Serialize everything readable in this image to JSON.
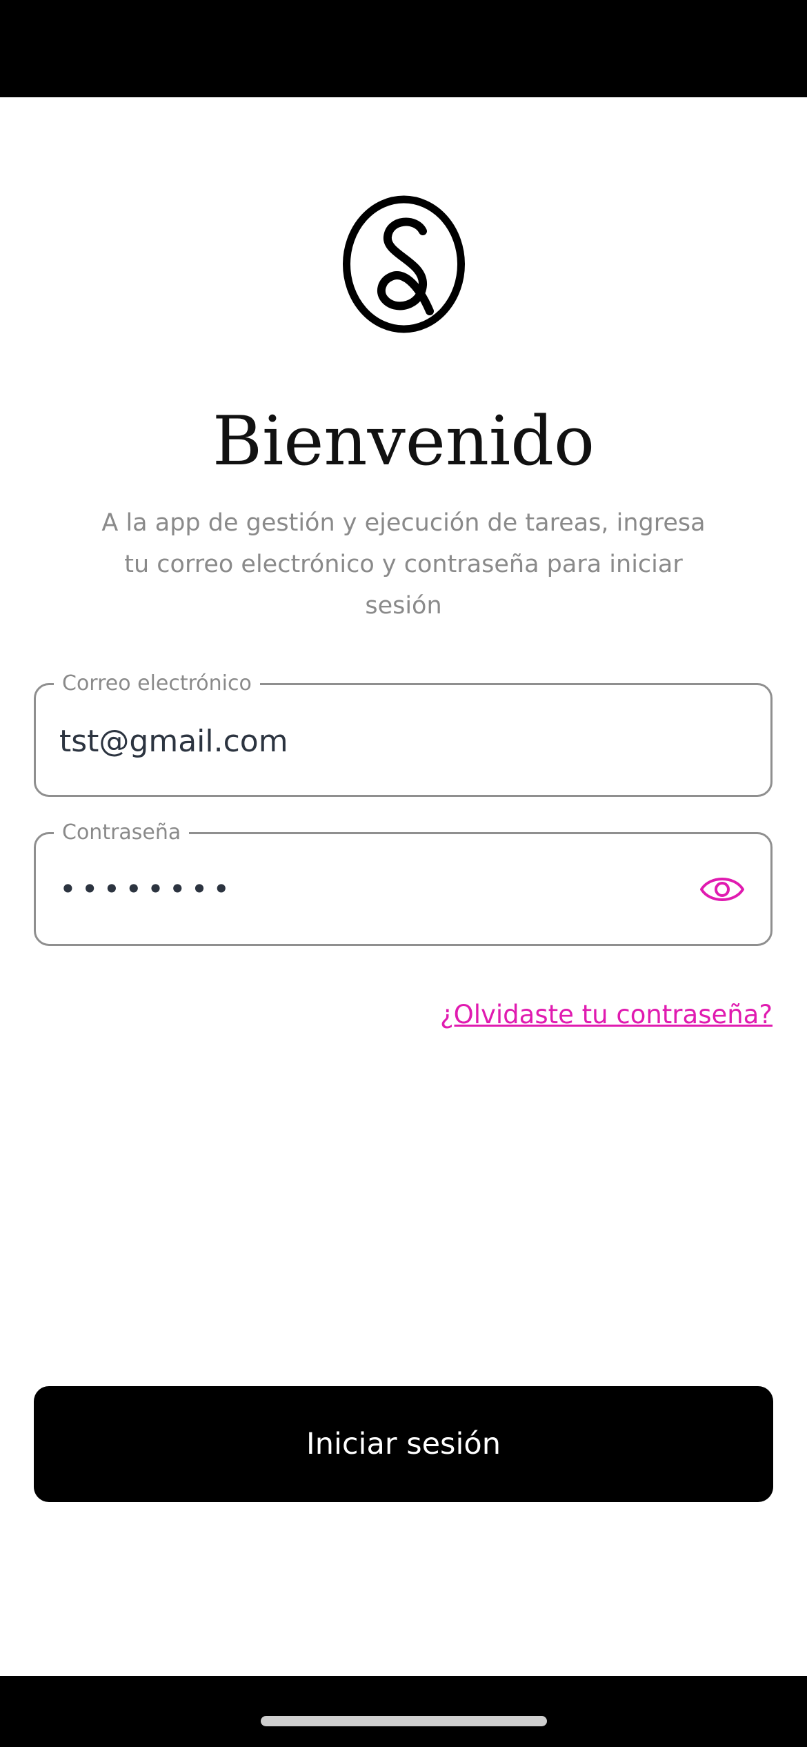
{
  "header": {
    "title": "Bienvenido",
    "subtitle": "A la app de gestión y ejecución de tareas, ingresa tu correo electrónico y contraseña para iniciar sesión"
  },
  "form": {
    "email": {
      "label": "Correo electrónico",
      "value": "tst@gmail.com"
    },
    "password": {
      "label": "Contraseña",
      "masked_value": "••••••••",
      "toggle_icon": "eye-icon"
    },
    "forgot_password_label": "¿Olvidaste tu contraseña?",
    "submit_label": "Iniciar sesión"
  },
  "colors": {
    "accent": "#e01bb0",
    "button_bg": "#000000",
    "text_muted": "#8a8a8a",
    "input_text": "#2c3440",
    "border": "#8f8f8f"
  }
}
